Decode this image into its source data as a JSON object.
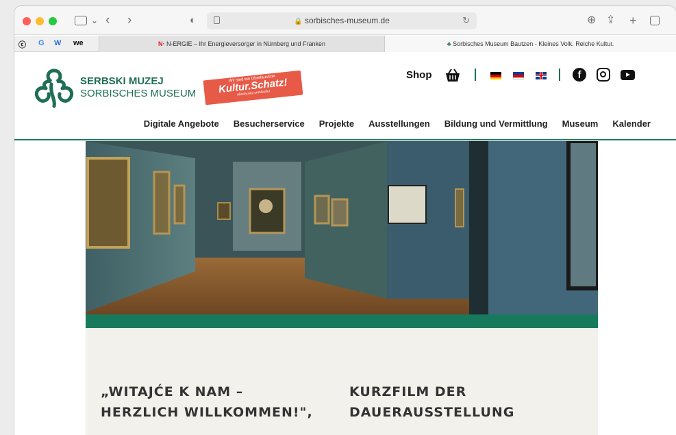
{
  "browser": {
    "url": "sorbisches-museum.de",
    "favorites": [
      "G",
      "W",
      "we"
    ],
    "tabs": [
      {
        "icon": "N·",
        "title": "N-ERGIE – Ihr Energieversorger in Nürnberg und Franken"
      },
      {
        "title": "Sorbisches Museum Bautzen - Kleines Volk. Reiche Kultur."
      }
    ]
  },
  "site": {
    "logo": {
      "line1": "SERBSKI MUZEJ",
      "line2": "SORBISCHES MUSEUM"
    },
    "badge": {
      "small": "Wir sind ein Oberlausitzer",
      "big": "Kultur.Schatz!",
      "url": "oberlausitz.com/kultur"
    },
    "shop": "Shop",
    "nav": [
      "Digitale Angebote",
      "Besucherservice",
      "Projekte",
      "Ausstellungen",
      "Bildung und Vermittlung",
      "Museum",
      "Kalender"
    ],
    "headings": {
      "left": "„WITAJĆE K NAM – HERZLICH WILLKOMMEN!\",",
      "right": "KURZFILM DER DAUERAUSSTELLUNG"
    },
    "colors": {
      "brand": "#1f6e55",
      "accent": "#177a5c",
      "badge": "#e85a48"
    }
  }
}
